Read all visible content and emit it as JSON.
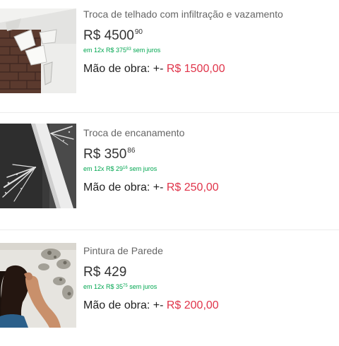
{
  "listings": [
    {
      "title": "Troca de telhado com infiltração e vazamento",
      "price_main": "R$ 4500",
      "price_cents": "90",
      "installment_prefix": "em 12x R$ 375",
      "installment_cents": "83",
      "installment_suffix": "sem juros",
      "labor_label": "Mão de obra: +-",
      "labor_value": "R$ 1500,00",
      "image": "roof-leak-photo"
    },
    {
      "title": "Troca de encanamento",
      "price_main": "R$ 350",
      "price_cents": "86",
      "installment_prefix": "em 12x R$ 29",
      "installment_cents": "16",
      "installment_suffix": "sem juros",
      "labor_label": "Mão de obra: +-",
      "labor_value": "R$ 250,00",
      "image": "burst-pipe-photo"
    },
    {
      "title": "Pintura de Parede",
      "price_main": "R$ 429",
      "price_cents": "",
      "installment_prefix": "em 12x R$ 35",
      "installment_cents": "75",
      "installment_suffix": "sem juros",
      "labor_label": "Mão de obra: +-",
      "labor_value": "R$ 200,00",
      "image": "moldy-wall-photo"
    }
  ],
  "colors": {
    "installment_green": "#00a650",
    "labor_red": "#e0344a",
    "divider": "#ececec"
  }
}
